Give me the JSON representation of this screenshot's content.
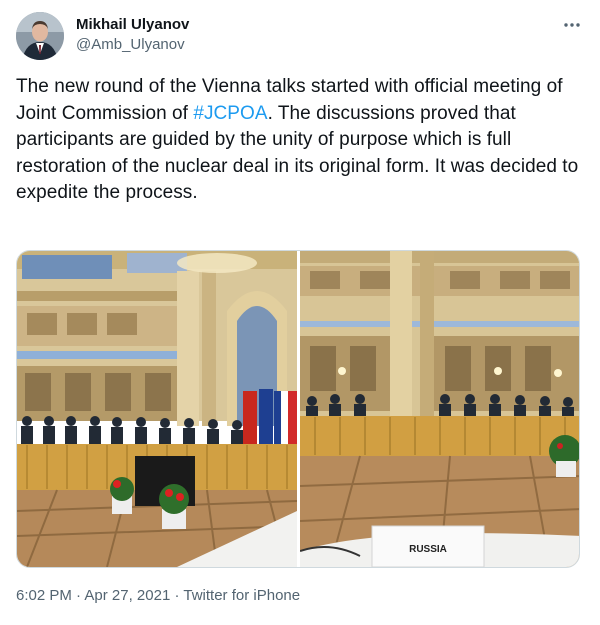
{
  "author": {
    "display_name": "Mikhail Ulyanov",
    "handle": "@Amb_Ulyanov",
    "avatar_icon": "profile-photo"
  },
  "more_icon": "more-dots-icon",
  "tweet": {
    "text_before": "The new round of the Vienna talks started with official meeting of Joint Commission of ",
    "hashtag": "#JCPOA",
    "text_after": ". The discussions proved that participants are guided by the unity of purpose which is full restoration of the nuclear deal in its original form. It was decided to expedite the process."
  },
  "media": {
    "photos": [
      {
        "name": "meeting-hall-photo-left"
      },
      {
        "name": "meeting-hall-photo-right"
      }
    ],
    "name_plate_text": "RUSSIA"
  },
  "meta": {
    "time": "6:02 PM",
    "separator": "·",
    "date": "Apr 27, 2021",
    "source": "Twitter for iPhone"
  },
  "colors": {
    "link": "#1d9bf0",
    "text": "#0f1419",
    "secondary": "#536471"
  }
}
